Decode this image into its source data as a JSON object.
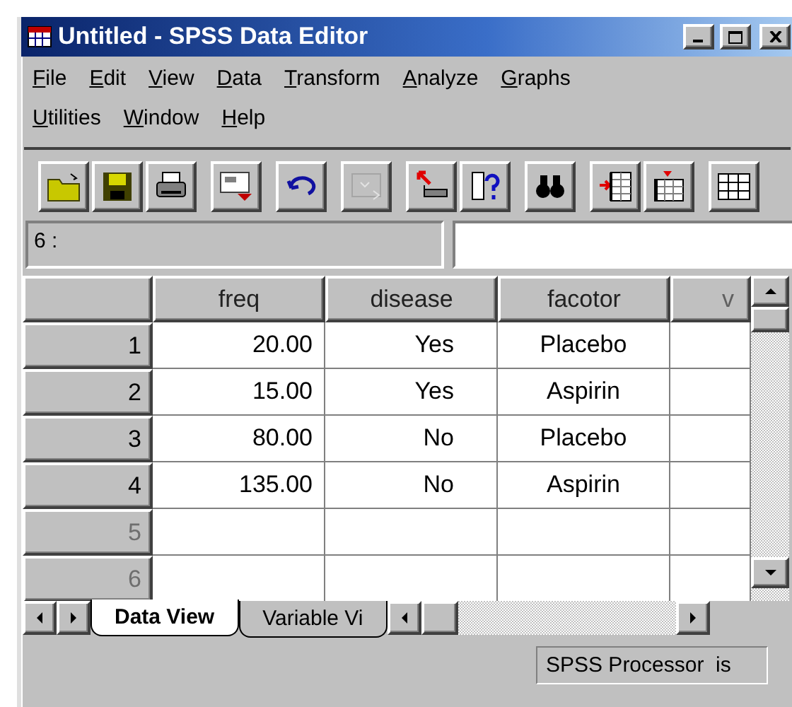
{
  "window": {
    "title": "Untitled - SPSS Data Editor"
  },
  "menu_rows": [
    [
      "File",
      "Edit",
      "View",
      "Data",
      "Transform",
      "Analyze",
      "Graphs"
    ],
    [
      "Utilities",
      "Window",
      "Help"
    ]
  ],
  "toolbar_buttons": [
    {
      "disabled": false
    },
    {
      "disabled": false
    },
    {
      "disabled": false
    },
    {
      "disabled": false
    },
    {
      "disabled": false
    },
    {
      "disabled": true
    },
    {
      "disabled": false
    },
    {
      "disabled": false
    },
    {
      "disabled": false
    },
    {
      "disabled": false
    },
    {
      "disabled": false
    },
    {
      "disabled": false
    }
  ],
  "cell_reference": "6 :",
  "table": {
    "columns": [
      "freq",
      "disease",
      "facotor",
      "v"
    ],
    "rows": [
      {
        "number": "1",
        "disabled": false,
        "cells": [
          "20.00",
          "Yes",
          "Placebo",
          ""
        ]
      },
      {
        "number": "2",
        "disabled": false,
        "cells": [
          "15.00",
          "Yes",
          "Aspirin",
          ""
        ]
      },
      {
        "number": "3",
        "disabled": false,
        "cells": [
          "80.00",
          "No",
          "Placebo",
          ""
        ]
      },
      {
        "number": "4",
        "disabled": false,
        "cells": [
          "135.00",
          "No",
          "Aspirin",
          ""
        ]
      },
      {
        "number": "5",
        "disabled": true,
        "cells": [
          "",
          "",
          "",
          ""
        ]
      },
      {
        "number": "6",
        "disabled": true,
        "cells": [
          "",
          "",
          "",
          ""
        ]
      }
    ]
  },
  "tabs": [
    {
      "label": "Data View",
      "selected": true
    },
    {
      "label": "Variable Vi",
      "selected": false
    }
  ],
  "status_bar": "SPSS Processor  is"
}
